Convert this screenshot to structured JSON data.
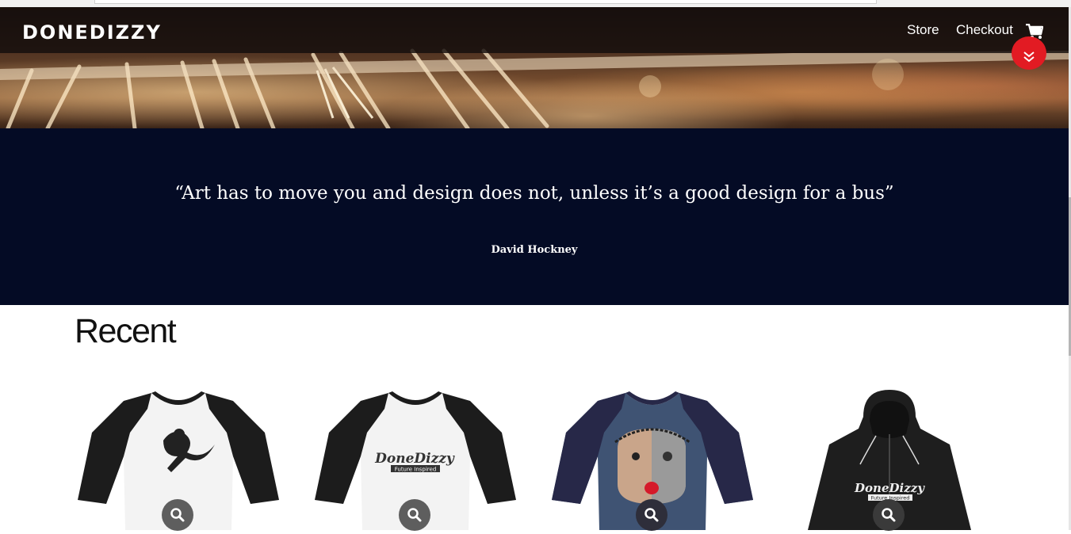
{
  "brand": {
    "logo": "DONEDIZZY"
  },
  "nav": {
    "items": [
      {
        "label": "Store"
      },
      {
        "label": "Checkout"
      }
    ]
  },
  "icons": {
    "cart": "shopping-cart-icon",
    "scroll": "double-chevron-down-icon",
    "zoom": "magnifier-icon"
  },
  "colors": {
    "accent": "#e21b23",
    "navbar": "#140e0c",
    "quote_band": "#040b25",
    "zoom_button": "#5e5e5e"
  },
  "quote": {
    "text": "“Art has to move you and design does not, unless it’s a good design for a bus”",
    "author": "David Hockney"
  },
  "recent": {
    "title": "Recent",
    "products": [
      {
        "type": "raglan-tee",
        "body_color": "#f3f3f3",
        "sleeve_color": "#1c1c1c",
        "graphic": "figure-illustration"
      },
      {
        "type": "raglan-tee",
        "body_color": "#f3f3f3",
        "sleeve_color": "#1c1c1c",
        "graphic": "logo-print",
        "print_text": "DoneDizzy",
        "print_tagline": "Future Inspired"
      },
      {
        "type": "raglan-tee",
        "body_color": "#3f5373",
        "sleeve_color": "#272848",
        "graphic": "face-illustration"
      },
      {
        "type": "zip-hoodie",
        "body_color": "#1e1e1e",
        "graphic": "logo-print",
        "print_text": "DoneDizzy",
        "print_tagline": "Future Inspired"
      }
    ]
  }
}
